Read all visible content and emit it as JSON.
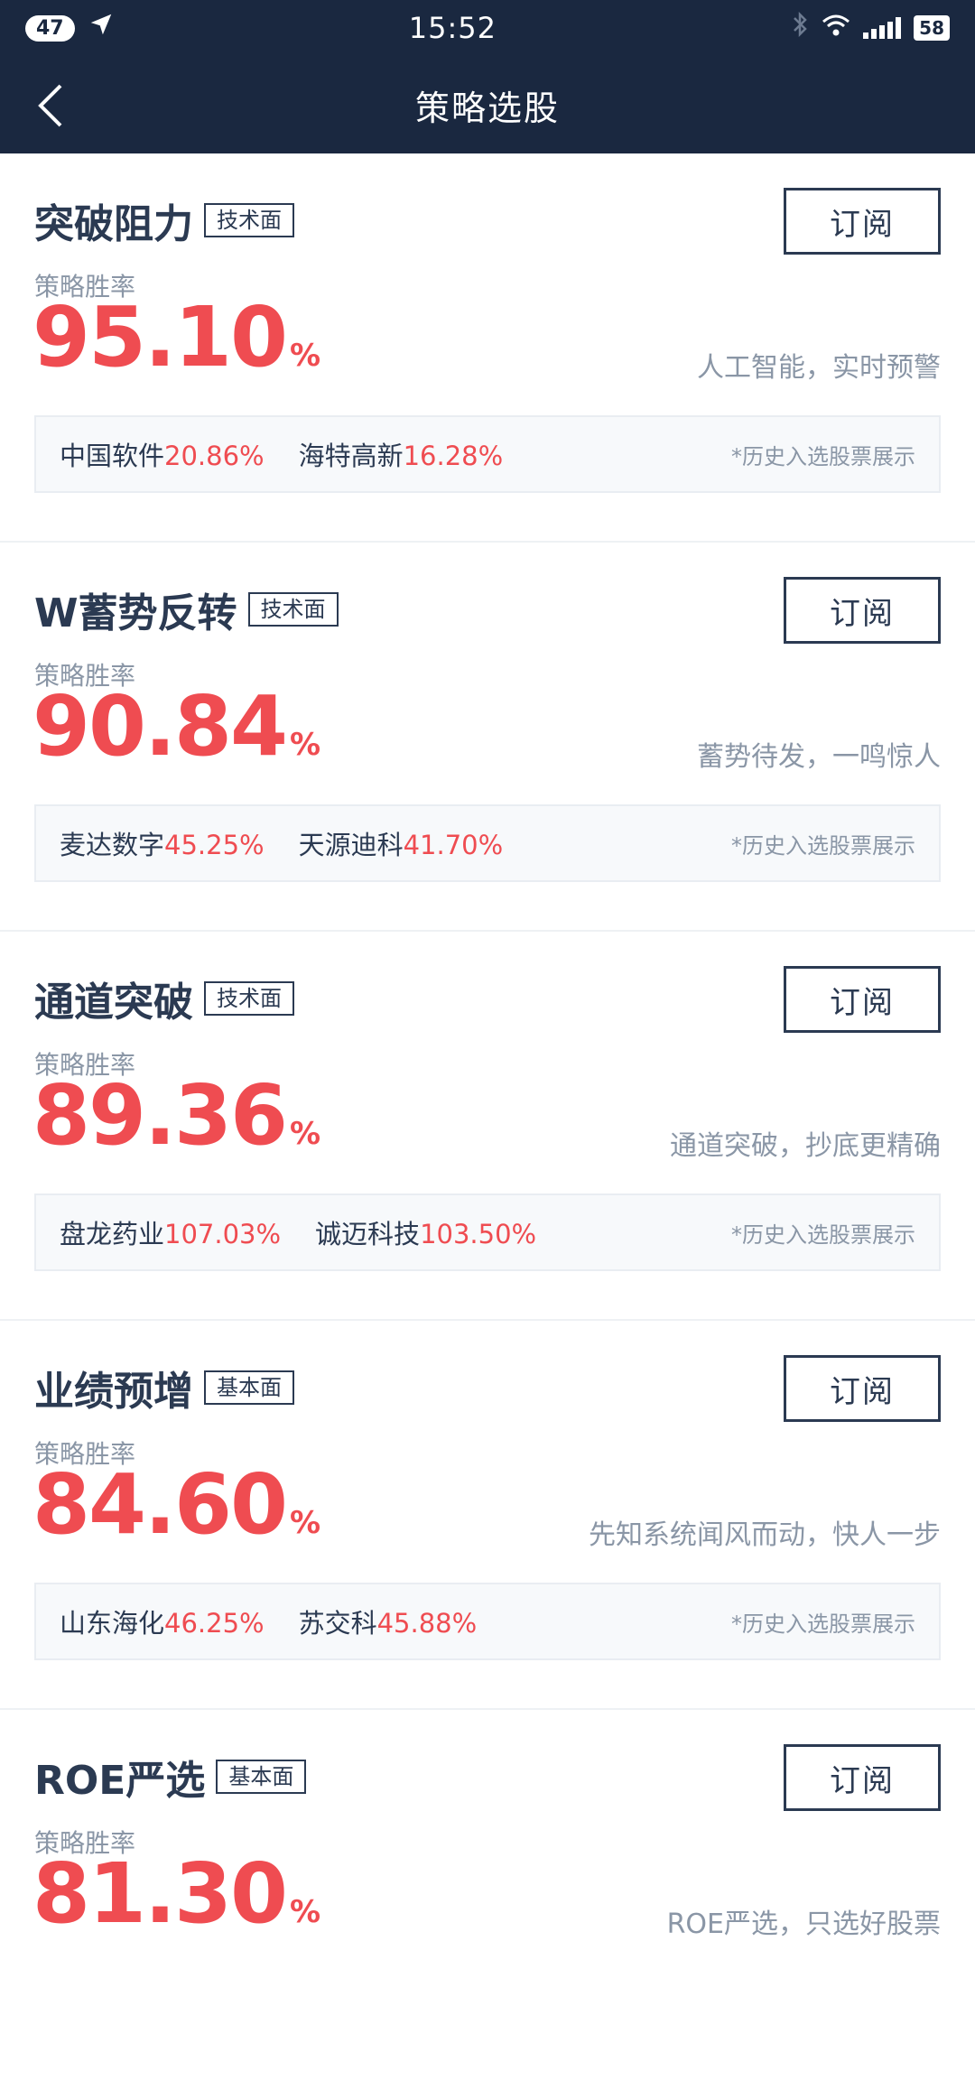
{
  "statusbar": {
    "badge": "47",
    "time": "15:52",
    "battery": "58"
  },
  "navbar": {
    "title": "策略选股"
  },
  "strategies": [
    {
      "title": "突破阻力",
      "tag": "技术面",
      "subscribe": "订阅",
      "rate_label": "策略胜率",
      "rate": "95.10",
      "pct": "%",
      "slogan": "人工智能，实时预警",
      "stocks": [
        {
          "name": "中国软件",
          "gain": "20.86%"
        },
        {
          "name": "海特高新",
          "gain": "16.28%"
        }
      ],
      "note": "*历史入选股票展示"
    },
    {
      "title": "W蓄势反转",
      "tag": "技术面",
      "subscribe": "订阅",
      "rate_label": "策略胜率",
      "rate": "90.84",
      "pct": "%",
      "slogan": "蓄势待发，一鸣惊人",
      "stocks": [
        {
          "name": "麦达数字",
          "gain": "45.25%"
        },
        {
          "name": "天源迪科",
          "gain": "41.70%"
        }
      ],
      "note": "*历史入选股票展示"
    },
    {
      "title": "通道突破",
      "tag": "技术面",
      "subscribe": "订阅",
      "rate_label": "策略胜率",
      "rate": "89.36",
      "pct": "%",
      "slogan": "通道突破，抄底更精确",
      "stocks": [
        {
          "name": "盘龙药业",
          "gain": "107.03%"
        },
        {
          "name": "诚迈科技",
          "gain": "103.50%"
        }
      ],
      "note": "*历史入选股票展示"
    },
    {
      "title": "业绩预增",
      "tag": "基本面",
      "subscribe": "订阅",
      "rate_label": "策略胜率",
      "rate": "84.60",
      "pct": "%",
      "slogan": "先知系统闻风而动，快人一步",
      "stocks": [
        {
          "name": "山东海化",
          "gain": "46.25%"
        },
        {
          "name": "苏交科",
          "gain": "45.88%"
        }
      ],
      "note": "*历史入选股票展示"
    },
    {
      "title": "ROE严选",
      "tag": "基本面",
      "subscribe": "订阅",
      "rate_label": "策略胜率",
      "rate": "81.30",
      "pct": "%",
      "slogan": "ROE严选，只选好股票"
    }
  ]
}
